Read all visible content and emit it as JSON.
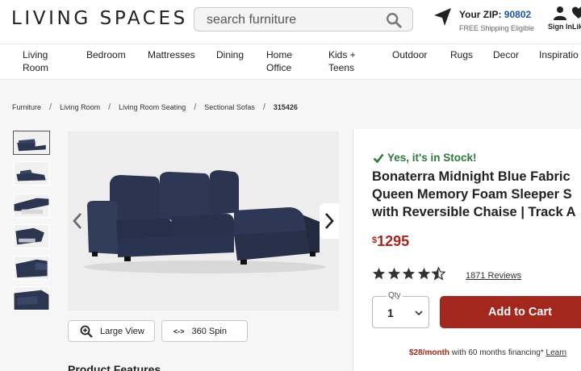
{
  "header": {
    "logo": "LIVING SPACES",
    "search_placeholder": "search furniture",
    "zip_label": "Your ZIP:",
    "zip_code": "90802",
    "shipping_note": "FREE Shipping Eligible",
    "signin_label": "Sign In",
    "signin_suffix": "Lik",
    "icons": [
      "search-icon",
      "location-arrow-icon",
      "person-icon",
      "heart-icon"
    ]
  },
  "nav": {
    "items": [
      {
        "label": "Living\nRoom"
      },
      {
        "label": "Bedroom"
      },
      {
        "label": "Mattresses"
      },
      {
        "label": "Dining"
      },
      {
        "label": "Home\nOffice"
      },
      {
        "label": "Kids +\nTeens"
      },
      {
        "label": "Outdoor"
      },
      {
        "label": "Rugs"
      },
      {
        "label": "Decor"
      },
      {
        "label": "Inspiratio"
      }
    ]
  },
  "breadcrumb": {
    "items": [
      "Furniture",
      "Living Room",
      "Living Room Seating",
      "Sectional Sofas",
      "315426"
    ],
    "separator": "/"
  },
  "gallery": {
    "thumbnail_count": 6,
    "selected_index": 0,
    "large_view_label": "Large View",
    "spin_label": "360 Spin",
    "spin_icon_text": "<->"
  },
  "product": {
    "stock_text": "Yes, it's in Stock!",
    "title_lines": [
      "Bonaterra Midnight Blue Fabric",
      "Queen Memory Foam Sleeper S",
      "with Reversible Chaise | Track A"
    ],
    "currency_symbol": "$",
    "price": "1295",
    "rating": 4.5,
    "reviews_text": "1871 Reviews",
    "qty_label": "Qty",
    "qty_value": "1",
    "add_to_cart_label": "Add to Cart",
    "financing_amount": "$28/month",
    "financing_text": " with 60 months financing*",
    "learn_label": "Learn"
  },
  "features_heading": "Product Features",
  "colors": {
    "brand_red": "#a3271c",
    "stock_green": "#2d7a3a",
    "zip_blue": "#1a55a8",
    "sofa_navy": "#2c3650"
  }
}
